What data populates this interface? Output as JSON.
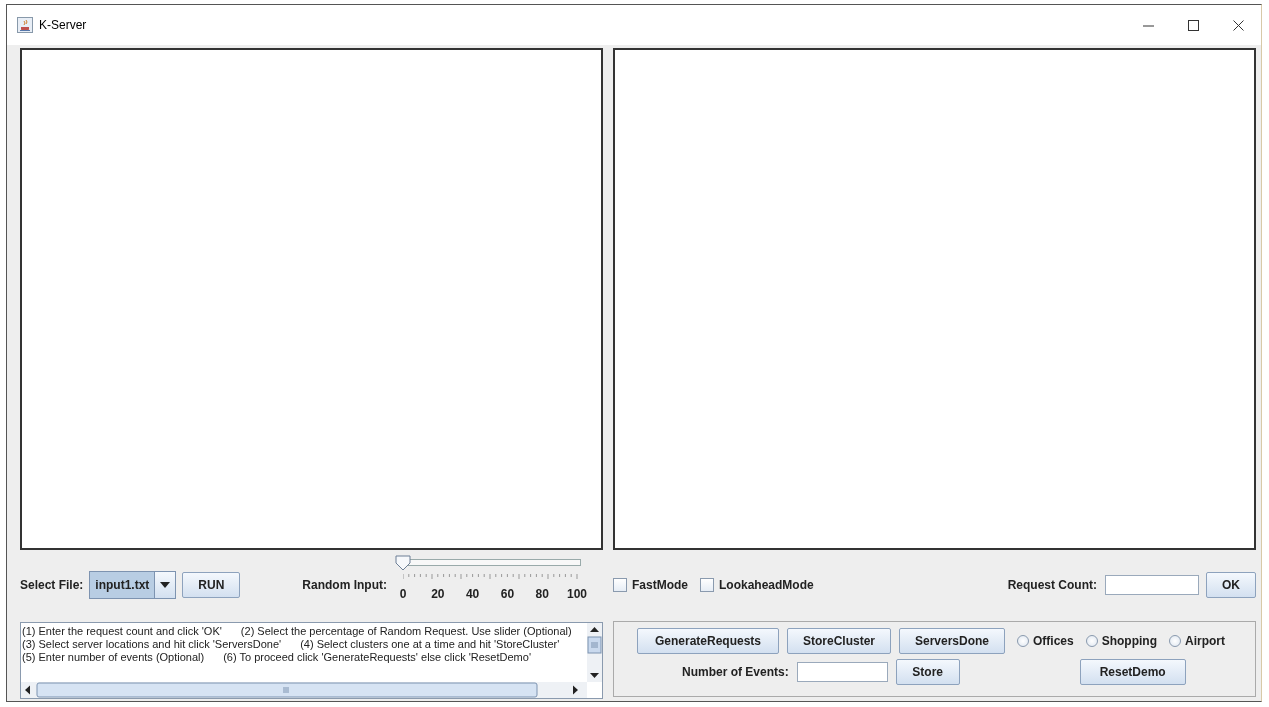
{
  "window": {
    "title": "K-Server"
  },
  "file_select": {
    "label": "Select File:",
    "value": "input1.txt"
  },
  "run_button": "RUN",
  "random_input": {
    "label": "Random Input:",
    "level": 0,
    "ticks": [
      "0",
      "20",
      "40",
      "60",
      "80",
      "100"
    ]
  },
  "modes": [
    {
      "label": "FastMode",
      "checked": false
    },
    {
      "label": "LookaheadMode",
      "checked": false
    }
  ],
  "request_count": {
    "label": "Request Count:",
    "button": "OK"
  },
  "instructions": [
    [
      "(1) Enter the request count and click 'OK'",
      "(2) Select the percentage of Random Request. Use slider (Optional)"
    ],
    [
      "(3) Select server locations and hit click 'ServersDone'",
      "(4) Select clusters one at a time and hit 'StoreCluster'"
    ],
    [
      "(5) Enter number of events (Optional)",
      "(6) To proceed click 'GenerateRequests' else click 'ResetDemo'"
    ]
  ],
  "actions": [
    "GenerateRequests",
    "StoreCluster",
    "ServersDone"
  ],
  "locations": [
    {
      "label": "Offices",
      "selected": false
    },
    {
      "label": "Shopping",
      "selected": false
    },
    {
      "label": "Airport",
      "selected": false
    }
  ],
  "events": {
    "label": "Number of Events:",
    "button": "Store"
  },
  "reset_button": "ResetDemo"
}
